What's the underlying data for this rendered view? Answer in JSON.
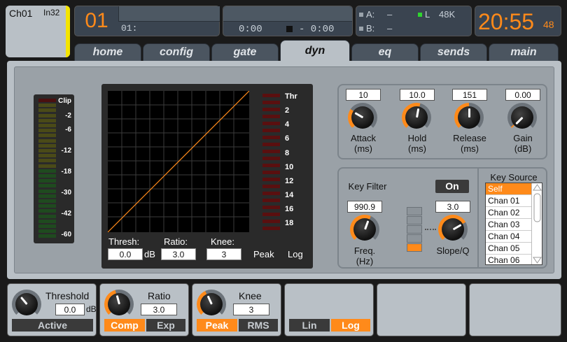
{
  "header": {
    "channel_name": "Ch01",
    "channel_source": "In32",
    "scene_number": "01",
    "scene_label": "01:",
    "transport_elapsed": "0:00",
    "transport_remaining": "- 0:00",
    "io": {
      "a_label": "A:",
      "a_value": "–",
      "b_label": "B:",
      "b_value": "–",
      "l_label": "L",
      "sample_rate": "48K"
    },
    "clock": "20:55",
    "clock_seconds": "48"
  },
  "tabs": [
    {
      "label": "home"
    },
    {
      "label": "config"
    },
    {
      "label": "gate"
    },
    {
      "label": "dyn"
    },
    {
      "label": "eq"
    },
    {
      "label": "sends"
    },
    {
      "label": "main"
    }
  ],
  "active_tab": "dyn",
  "left_meter": {
    "labels": [
      "Clip",
      "-2",
      "-6",
      "-12",
      "-18",
      "-30",
      "-42",
      "-60"
    ]
  },
  "graph": {
    "thresh_label": "Thresh:",
    "thresh_value": "0.0",
    "thresh_unit": "dB",
    "ratio_label": "Ratio:",
    "ratio_value": "3.0",
    "knee_label": "Knee:",
    "knee_value": "3",
    "peak_label": "Peak",
    "log_label": "Log",
    "gr_labels": [
      "Thr",
      "2",
      "4",
      "6",
      "8",
      "10",
      "12",
      "14",
      "16",
      "18"
    ]
  },
  "dynamics": {
    "attack": {
      "value": "10",
      "label": "Attack",
      "unit": "(ms)"
    },
    "hold": {
      "value": "10.0",
      "label": "Hold",
      "unit": "(ms)"
    },
    "release": {
      "value": "151",
      "label": "Release",
      "unit": "(ms)"
    },
    "gain": {
      "value": "0.00",
      "label": "Gain",
      "unit": "(dB)"
    }
  },
  "key_filter": {
    "title": "Key Filter",
    "on_label": "On",
    "freq_value": "990.9",
    "freq_label": "Freq.",
    "freq_unit": "(Hz)",
    "slope_value": "3.0",
    "slope_label": "Slope/Q"
  },
  "key_source": {
    "title": "Key Source",
    "items": [
      "Self",
      "Chan 01",
      "Chan 02",
      "Chan 03",
      "Chan 04",
      "Chan 05",
      "Chan 06"
    ],
    "selected": "Self"
  },
  "bottom": {
    "threshold": {
      "title": "Threshold",
      "value": "0.0",
      "unit": "dB",
      "button": "Active"
    },
    "ratio": {
      "title": "Ratio",
      "value": "3.0",
      "opt_a": "Comp",
      "opt_b": "Exp"
    },
    "knee": {
      "title": "Knee",
      "value": "3",
      "opt_a": "Peak",
      "opt_b": "RMS"
    },
    "curve": {
      "opt_a": "Lin",
      "opt_b": "Log"
    }
  },
  "colors": {
    "accent": "#ff8a1a",
    "panel": "#b9c0c6",
    "dark": "#3a4450",
    "clip": "#2fd52f"
  }
}
